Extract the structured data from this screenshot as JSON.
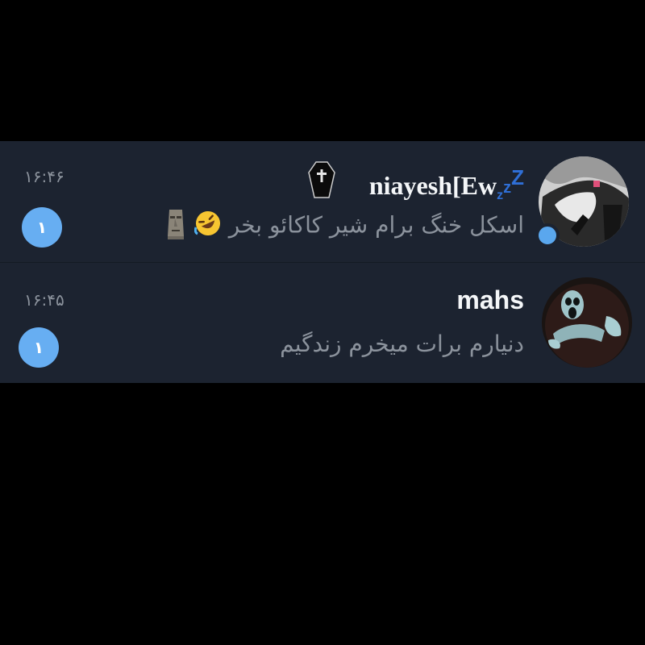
{
  "chats": [
    {
      "name": "niayesh[Ew",
      "name_suffix": "zzZ",
      "time": "۱۶:۴۶",
      "preview": "اسکل خنگ برام شیر کاکائو بخر",
      "unread": "۱",
      "online": true,
      "name_icon": "coffin-icon",
      "preview_emojis": [
        "rolling-on-floor-laughing-emoji",
        "moai-emoji"
      ],
      "avatar": "avatar-photo-hand"
    },
    {
      "name": "mahs",
      "time": "۱۶:۴۵",
      "preview": "دنیارم برات میخرم زندگیم",
      "unread": "۱",
      "avatar": "avatar-photo-ghost"
    }
  ],
  "colors": {
    "background": "#000000",
    "row_background": "#1c2330",
    "name_text": "#f4f6f8",
    "preview_text": "#8b929c",
    "badge": "#67aef2",
    "online_dot": "#5aa7ee",
    "zz_accent": "#2f6fd6"
  }
}
